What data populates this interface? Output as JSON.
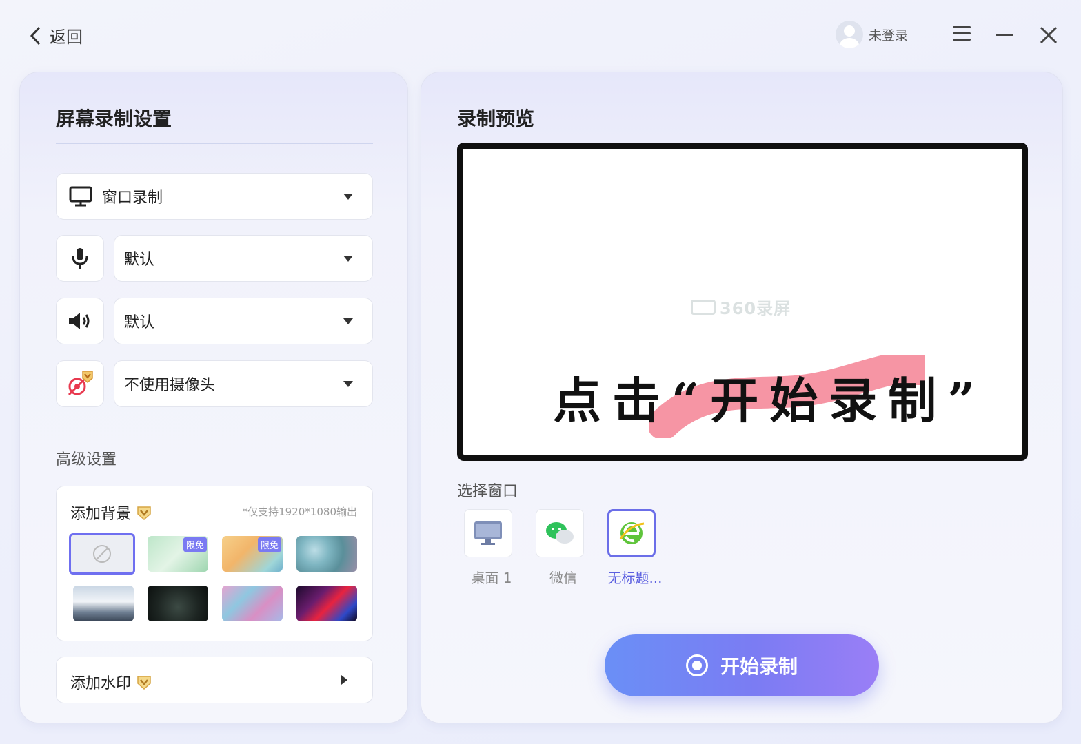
{
  "header": {
    "back_label": "返回",
    "user_label": "未登录"
  },
  "left_panel": {
    "title": "屏幕录制设置",
    "record_mode": "窗口录制",
    "microphone": "默认",
    "speaker": "默认",
    "camera": "不使用摄像头",
    "advanced_label": "高级设置",
    "background": {
      "title": "添加背景",
      "note": "*仅支持1920*1080输出",
      "tag_label": "限免"
    },
    "watermark_label": "添加水印"
  },
  "right_panel": {
    "title": "录制预览",
    "preview_logo": "360录屏",
    "hint_text": "点击“开始录制”",
    "select_window_label": "选择窗口",
    "windows": [
      {
        "name": "桌面 1"
      },
      {
        "name": "微信"
      },
      {
        "name": "无标题..."
      }
    ],
    "start_button": "开始录制"
  },
  "colors": {
    "accent": "#6b6ee8",
    "hint_highlight": "#f58a9a"
  }
}
